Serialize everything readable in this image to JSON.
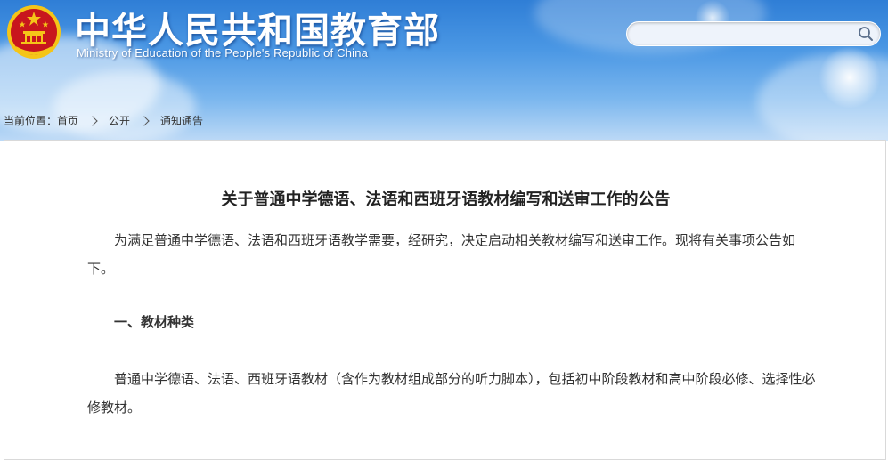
{
  "header": {
    "title": "中华人民共和国教育部",
    "subtitle": "Ministry of Education of the People's Republic of China",
    "emblem_icon": "national-emblem-icon"
  },
  "search": {
    "value": "",
    "placeholder": "",
    "icon": "search-icon"
  },
  "breadcrumb": {
    "prefix": "当前位置：",
    "items": [
      "首页",
      "公开",
      "通知通告"
    ]
  },
  "article": {
    "title": "关于普通中学德语、法语和西班牙语教材编写和送审工作的公告",
    "paragraph_1": "为满足普通中学德语、法语和西班牙语教学需要，经研究，决定启动相关教材编写和送审工作。现将有关事项公告如下。",
    "section_1_heading": "一、教材种类",
    "paragraph_2": "普通中学德语、法语、西班牙语教材（含作为教材组成部分的听力脚本），包括初中阶段教材和高中阶段必修、选择性必修教材。"
  },
  "colors": {
    "header_blue": "#2f7ed6",
    "emblem_red": "#c8161d",
    "emblem_gold": "#f5c518"
  }
}
